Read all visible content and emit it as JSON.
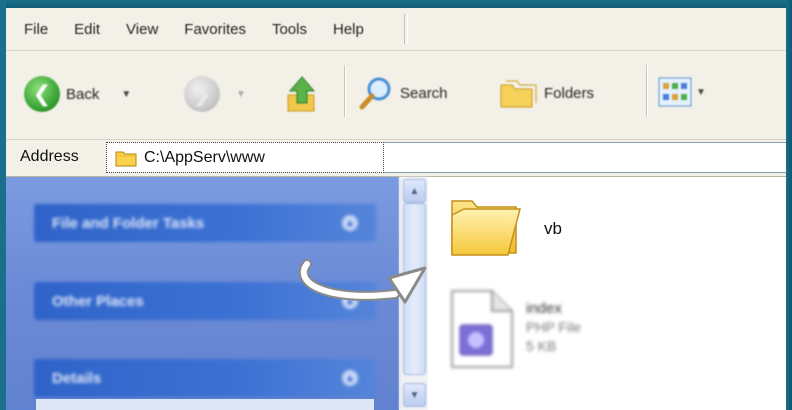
{
  "menubar": {
    "items": [
      "File",
      "Edit",
      "View",
      "Favorites",
      "Tools",
      "Help"
    ]
  },
  "toolbar": {
    "back_label": "Back",
    "search_label": "Search",
    "folders_label": "Folders"
  },
  "address": {
    "label": "Address",
    "value": "C:\\AppServ\\www"
  },
  "taskpane": {
    "sections": [
      "File and Folder Tasks",
      "Other Places",
      "Details"
    ]
  },
  "content": {
    "items": [
      {
        "name": "vb",
        "kind": "folder"
      },
      {
        "name": "index",
        "type": "PHP File",
        "size": "5 KB",
        "kind": "php-file"
      }
    ]
  },
  "colors": {
    "window_border": "#1a6f8a",
    "taskpane_bg": "#6b8ad6",
    "task_header": "#2f63c9",
    "folder_yellow": "#f7d24a"
  }
}
